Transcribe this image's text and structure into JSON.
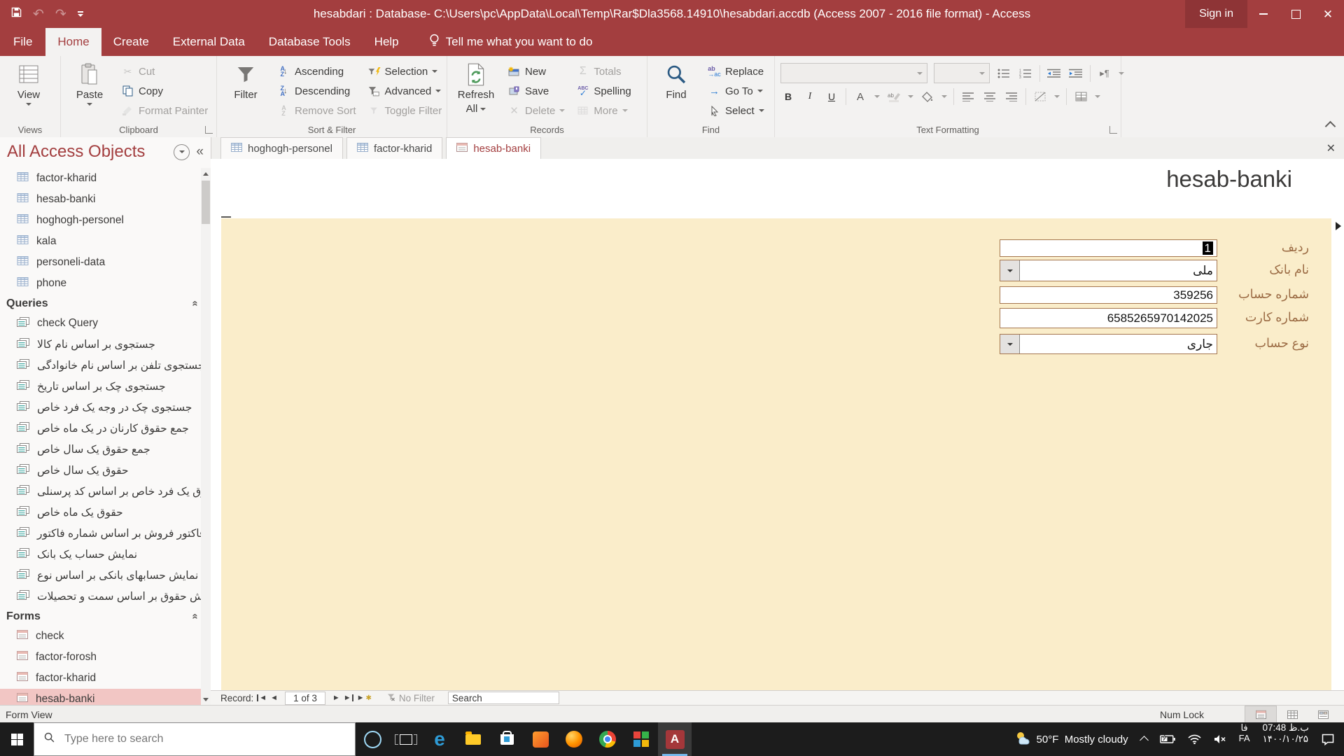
{
  "titlebar": {
    "title": "hesabdari : Database- C:\\Users\\pc\\AppData\\Local\\Temp\\Rar$Dla3568.14910\\hesabdari.accdb (Access 2007 - 2016 file format)  -  Access",
    "sign_in": "Sign in"
  },
  "menu": {
    "file": "File",
    "home": "Home",
    "create": "Create",
    "external_data": "External Data",
    "database_tools": "Database Tools",
    "help": "Help",
    "tell_me": "Tell me what you want to do"
  },
  "ribbon": {
    "views": {
      "label": "Views",
      "view": "View"
    },
    "clipboard": {
      "label": "Clipboard",
      "paste": "Paste",
      "cut": "Cut",
      "copy": "Copy",
      "format_painter": "Format Painter"
    },
    "sort_filter": {
      "label": "Sort & Filter",
      "filter": "Filter",
      "ascending": "Ascending",
      "descending": "Descending",
      "remove_sort": "Remove Sort",
      "selection": "Selection",
      "advanced": "Advanced",
      "toggle_filter": "Toggle Filter"
    },
    "records": {
      "label": "Records",
      "refresh_line1": "Refresh",
      "refresh_line2": "All",
      "new": "New",
      "save": "Save",
      "delete": "Delete",
      "totals": "Totals",
      "spelling": "Spelling",
      "more": "More"
    },
    "find": {
      "label": "Find",
      "find": "Find",
      "replace": "Replace",
      "go_to": "Go To",
      "select": "Select"
    },
    "text_formatting": {
      "label": "Text Formatting",
      "bold": "B",
      "italic": "I",
      "underline": "U"
    }
  },
  "doc_tabs": {
    "tabs": [
      "hoghogh-personel",
      "factor-kharid",
      "hesab-banki"
    ]
  },
  "nav": {
    "title": "All Access Objects",
    "tables": [
      "factor-kharid",
      "hesab-banki",
      "hoghogh-personel",
      "kala",
      "personeli-data",
      "phone"
    ],
    "queries_header": "Queries",
    "queries": [
      "check Query",
      "جستجوی بر اساس نام کالا",
      "جستجوی تلفن بر اساس نام خانوادگی",
      "جستجوی چک بر اساس تاریخ",
      "جستجوی چک در وجه یک فرد خاص",
      "جمع حقوق کارنان در یک ماه خاص",
      "جمع حقوق یک سال خاص",
      "حقوق یک سال خاص",
      "حقوق یک فرد خاص بر اساس کد پرسنلی",
      "حقوق یک ماه خاص",
      "فاکتور فروش بر اساس شماره فاکتور",
      "نمایش حساب یک بانک",
      "نمایش حسابهای بانکی بر اساس نوع",
      "نمایش حقوق بر اساس سمت و تحصیلات"
    ],
    "forms_header": "Forms",
    "forms": [
      "check",
      "factor-forosh",
      "factor-kharid",
      "hesab-banki"
    ]
  },
  "form": {
    "title": "hesab-banki",
    "fields": [
      {
        "label": "ردیف",
        "value": "1"
      },
      {
        "label": "نام بانک",
        "value": "ملی"
      },
      {
        "label": "شماره حساب",
        "value": "359256"
      },
      {
        "label": "شماره کارت",
        "value": "6585265970142025"
      },
      {
        "label": "نوع حساب",
        "value": "جاری"
      }
    ]
  },
  "record_bar": {
    "label": "Record:",
    "position": "1 of 3",
    "no_filter": "No Filter",
    "search_placeholder": "Search"
  },
  "status_bar": {
    "view": "Form View",
    "num_lock": "Num Lock"
  },
  "taskbar": {
    "search_placeholder": "Type here to search",
    "weather_temp": "50°F",
    "weather_condition": "Mostly cloudy",
    "lang_line1": "فا",
    "lang_line2": "FA",
    "time": "ب.ظ 07:48",
    "date": "۱۴۰۰/۱۰/۲۵"
  },
  "colors": {
    "accent": "#A33E3F",
    "form_bg": "#FAEDCA",
    "field_border": "#A5764E",
    "selection_pink": "#F2C6C4"
  }
}
